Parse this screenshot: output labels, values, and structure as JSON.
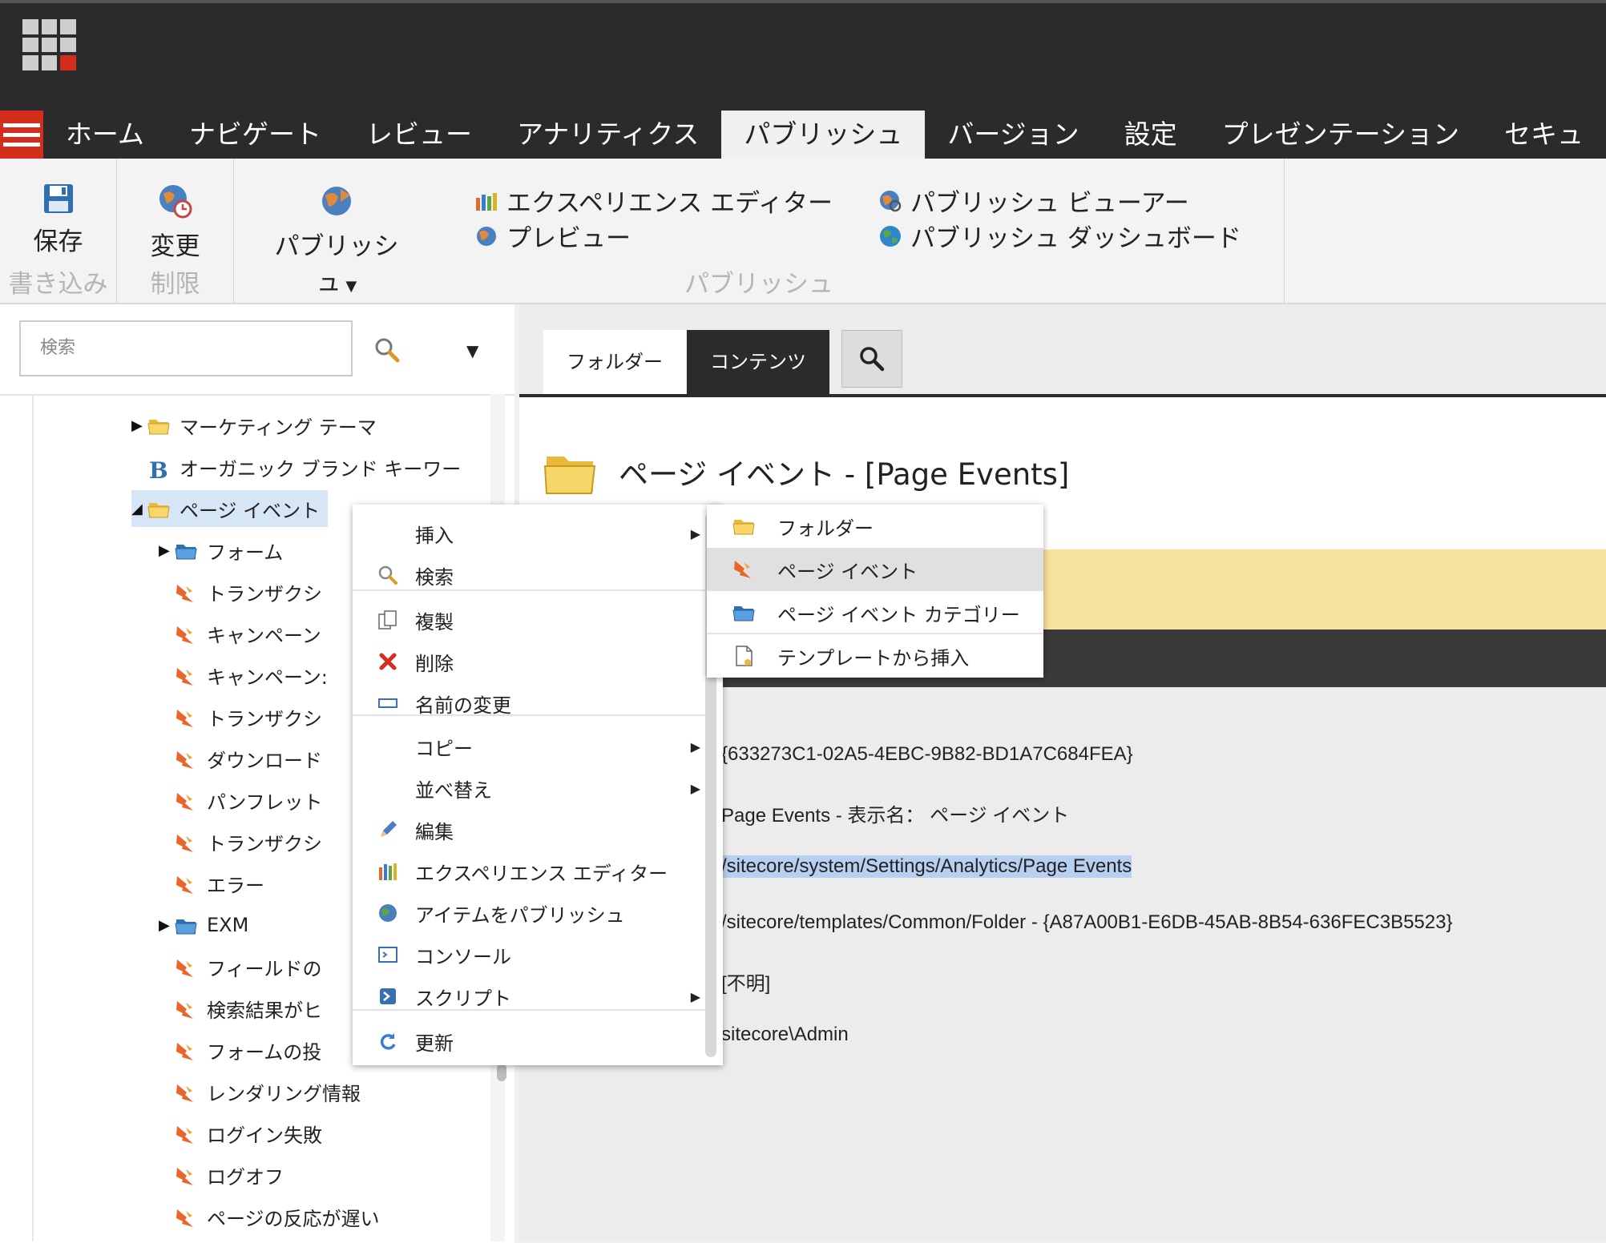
{
  "header": {
    "app_grid_icon": "app-grid-icon"
  },
  "tabs": [
    {
      "label": "ホーム"
    },
    {
      "label": "ナビゲート"
    },
    {
      "label": "レビュー"
    },
    {
      "label": "アナリティクス"
    },
    {
      "label": "パブリッシュ",
      "active": true
    },
    {
      "label": "バージョン"
    },
    {
      "label": "設定"
    },
    {
      "label": "プレゼンテーション"
    },
    {
      "label": "セキュ"
    }
  ],
  "ribbon": {
    "save_label": "保存",
    "write_group": "書き込み",
    "change_label": "変更",
    "restrict_group": "制限",
    "publish_label": "パブリッシュ",
    "publish_group": "パブリッシュ",
    "experience_editor": "エクスペリエンス エディター",
    "preview": "プレビュー",
    "publish_viewer": "パブリッシュ ビューアー",
    "publish_dashboard": "パブリッシュ ダッシュボード"
  },
  "search": {
    "placeholder": "検索"
  },
  "tree": [
    {
      "label": "マーケティング テーマ"
    },
    {
      "label": "オーガニック ブランド キーワー"
    },
    {
      "label": "ページ イベント"
    },
    {
      "label": "フォーム"
    },
    {
      "label": "トランザクシ"
    },
    {
      "label": "キャンペーン"
    },
    {
      "label": "キャンペーン:"
    },
    {
      "label": "トランザクシ"
    },
    {
      "label": "ダウンロード"
    },
    {
      "label": "パンフレット"
    },
    {
      "label": "トランザクシ"
    },
    {
      "label": "エラー"
    },
    {
      "label": "EXM"
    },
    {
      "label": "フィールドの"
    },
    {
      "label": "検索結果がヒ"
    },
    {
      "label": "フォームの投"
    },
    {
      "label": "レンダリング情報"
    },
    {
      "label": "ログイン失敗"
    },
    {
      "label": "ログオフ"
    },
    {
      "label": "ページの反応が遅い"
    }
  ],
  "content_tabs": {
    "folder": "フォルダー",
    "content": "コンテンツ"
  },
  "content": {
    "title": "ページ イベント - [Page Events]",
    "item_id": "{633273C1-02A5-4EBC-9B82-BD1A7C684FEA}",
    "item_name": "Page Events - 表示名： ページ イベント",
    "item_path": "/sitecore/system/Settings/Analytics/Page Events",
    "template": "/sitecore/templates/Common/Folder - {A87A00B1-E6DB-45AB-8B54-636FEC3B5523}",
    "created_from": "[不明]",
    "owner": "sitecore\\Admin"
  },
  "context_menu": [
    {
      "label": "挿入",
      "icon": "none",
      "submenu": true
    },
    {
      "label": "検索",
      "icon": "search-icon"
    },
    {
      "label": "複製",
      "icon": "duplicate-icon"
    },
    {
      "label": "削除",
      "icon": "delete-icon"
    },
    {
      "label": "名前の変更",
      "icon": "rename-icon"
    },
    {
      "label": "コピー",
      "icon": "none",
      "submenu": true
    },
    {
      "label": "並べ替え",
      "icon": "none",
      "submenu": true
    },
    {
      "label": "編集",
      "icon": "pencil-icon"
    },
    {
      "label": "エクスペリエンス エディター",
      "icon": "experience-editor-icon"
    },
    {
      "label": "アイテムをパブリッシュ",
      "icon": "publish-item-icon"
    },
    {
      "label": "コンソール",
      "icon": "console-icon"
    },
    {
      "label": "スクリプト",
      "icon": "script-icon",
      "submenu": true
    },
    {
      "label": "更新",
      "icon": "refresh-icon"
    }
  ],
  "insert_submenu": [
    {
      "label": "フォルダー",
      "icon": "folder-icon"
    },
    {
      "label": "ページ イベント",
      "icon": "page-event-icon"
    },
    {
      "label": "ページ イベント カテゴリー",
      "icon": "category-folder-icon"
    },
    {
      "label": "テンプレートから挿入",
      "icon": "template-icon"
    }
  ]
}
